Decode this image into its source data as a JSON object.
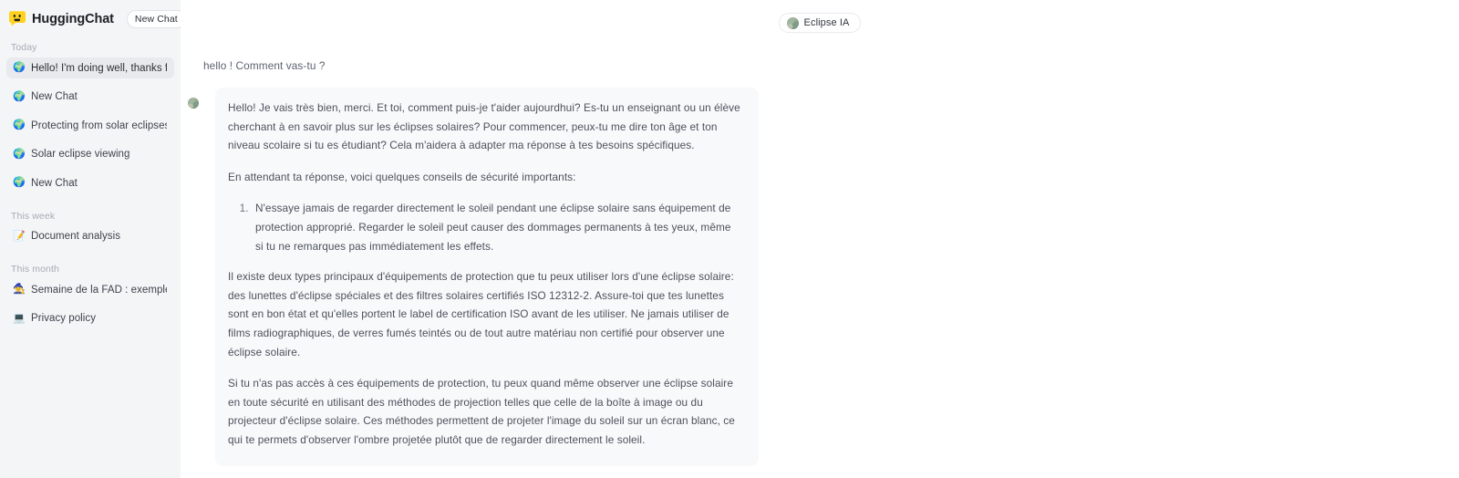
{
  "app": {
    "brand_name": "HuggingChat",
    "logo_icon": "speech-bubble-smile-icon",
    "new_chat_label": "New Chat"
  },
  "sidebar": {
    "groups": [
      {
        "label": "Today",
        "items": [
          {
            "icon": "globe-avatar-icon",
            "title": "Hello! I'm doing well, thanks for ",
            "active": true
          },
          {
            "icon": "globe-avatar-icon",
            "title": "New Chat",
            "active": false
          },
          {
            "icon": "globe-avatar-icon",
            "title": "Protecting from solar eclipses",
            "active": false
          },
          {
            "icon": "globe-avatar-icon",
            "title": "Solar eclipse viewing",
            "active": false
          },
          {
            "icon": "globe-avatar-icon",
            "title": "New Chat",
            "active": false
          }
        ]
      },
      {
        "label": "This week",
        "items": [
          {
            "icon": "memo-icon",
            "emoji": "📝",
            "title": "Document analysis",
            "active": false
          }
        ]
      },
      {
        "label": "This month",
        "items": [
          {
            "icon": "mage-icon",
            "emoji": "🧙",
            "title": "Semaine de la FAD : exemple",
            "active": false
          },
          {
            "icon": "laptop-icon",
            "emoji": "💻",
            "title": "Privacy policy",
            "active": false
          }
        ]
      }
    ]
  },
  "main": {
    "model_pill": {
      "label": "Eclipse IA",
      "avatar_icon": "assistant-avatar-icon"
    },
    "user_message": "hello ! Comment vas-tu ?",
    "assistant_message": {
      "avatar_icon": "assistant-avatar-icon",
      "paragraph_1": "Hello! Je vais très bien, merci. Et toi, comment puis-je t'aider aujourdhui? Es-tu un enseignant ou un élève cherchant à en savoir plus sur les éclipses solaires? Pour commencer, peux-tu me dire ton âge et ton niveau scolaire si tu es étudiant? Cela m'aidera à adapter ma réponse à tes besoins spécifiques.",
      "paragraph_2": "En attendant ta réponse, voici quelques conseils de sécurité importants:",
      "list_item_1": "N'essaye jamais de regarder directement le soleil pendant une éclipse solaire sans équipement de protection approprié. Regarder le soleil peut causer des dommages permanents à tes yeux, même si tu ne remarques pas immédiatement les effets.",
      "paragraph_3": "Il existe deux types principaux d'équipements de protection que tu peux utiliser lors d'une éclipse solaire: des lunettes d'éclipse spéciales et des filtres solaires certifiés ISO 12312-2. Assure-toi que tes lunettes sont en bon état et qu'elles portent le label de certification ISO avant de les utiliser. Ne jamais utiliser de films radiographiques, de verres fumés teintés ou de tout autre matériau non certifié pour observer une éclipse solaire.",
      "paragraph_4": "Si tu n'as pas accès à ces équipements de protection, tu peux quand même observer une éclipse solaire en toute sécurité en utilisant des méthodes de projection telles que celle de la boîte à image ou du projecteur d'éclipse solaire. Ces méthodes permettent de projeter l'image du soleil sur un écran blanc, ce qui te permets d'observer l'ombre projetée plutôt que de regarder directement le soleil."
    }
  },
  "colors": {
    "sidebar_bg": "#f4f5f7",
    "sidebar_active": "#e9eaed",
    "bubble_bg": "#f8f9fa",
    "brand_yellow": "#ffd21e",
    "text_primary": "#1b1f25",
    "text_body": "#4b515c",
    "text_muted": "#a5abb5"
  }
}
